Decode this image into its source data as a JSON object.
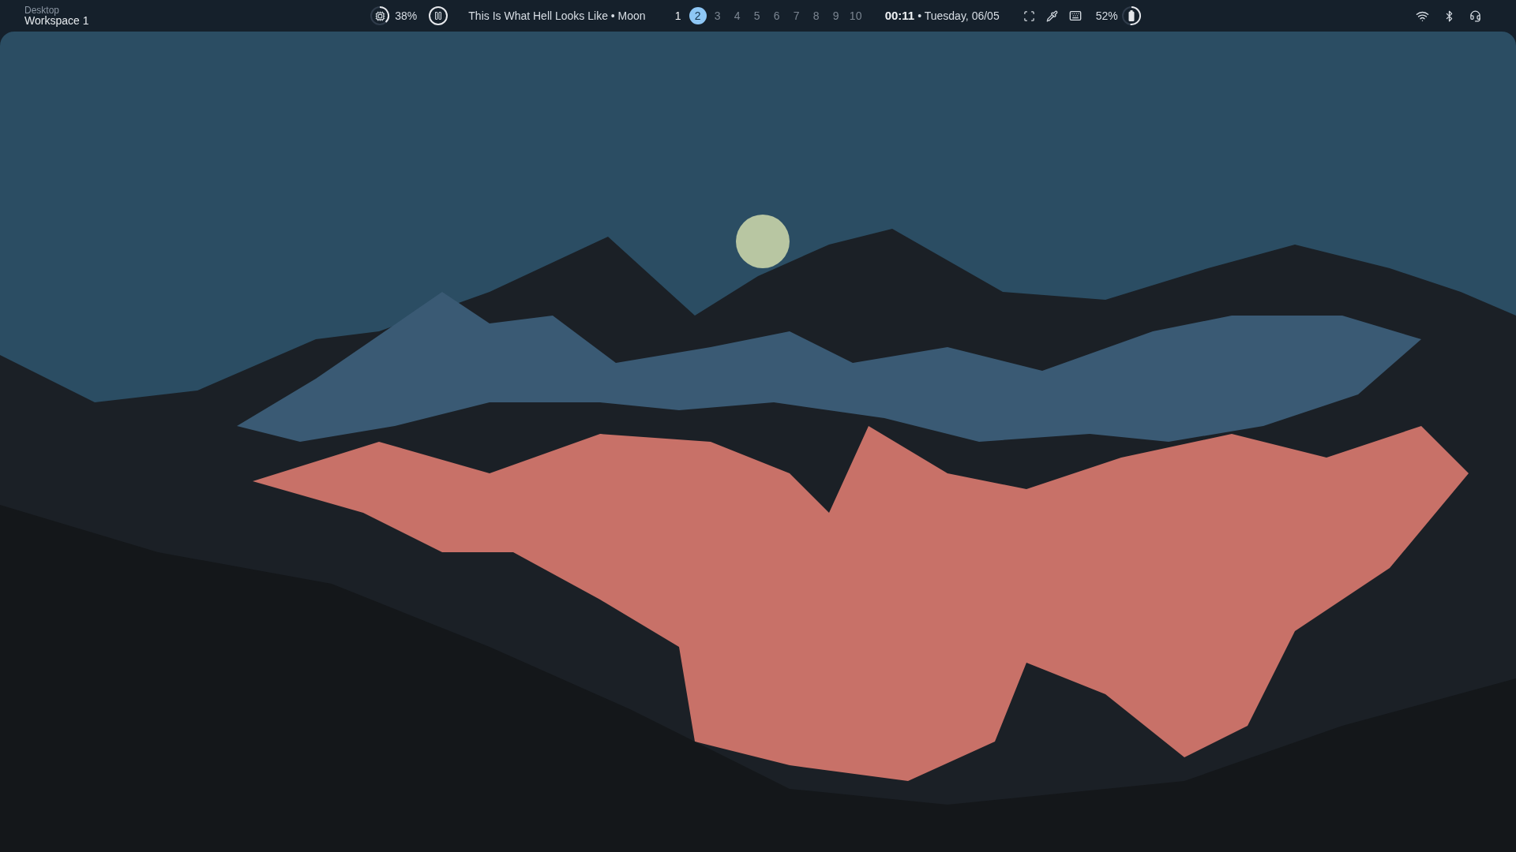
{
  "bar": {
    "workspace": {
      "label": "Desktop",
      "name": "Workspace 1"
    },
    "cpu": {
      "level": 0.38,
      "reading": "38%"
    },
    "media": {
      "title": "This Is What Hell Looks Like • Moon"
    },
    "workspaces": [
      {
        "label": "1",
        "selected": false,
        "occupied": true
      },
      {
        "label": "2",
        "selected": true,
        "occupied": true
      },
      {
        "label": "3",
        "selected": false,
        "occupied": false
      },
      {
        "label": "4",
        "selected": false,
        "occupied": false
      },
      {
        "label": "5",
        "selected": false,
        "occupied": false
      },
      {
        "label": "6",
        "selected": false,
        "occupied": false
      },
      {
        "label": "7",
        "selected": false,
        "occupied": false
      },
      {
        "label": "8",
        "selected": false,
        "occupied": false
      },
      {
        "label": "9",
        "selected": false,
        "occupied": false
      },
      {
        "label": "10",
        "selected": false,
        "occupied": false
      }
    ],
    "clock": {
      "time": "00:11",
      "date": "• Tuesday, 06/05"
    },
    "battery": {
      "level": 0.52,
      "reading": "52%"
    }
  }
}
